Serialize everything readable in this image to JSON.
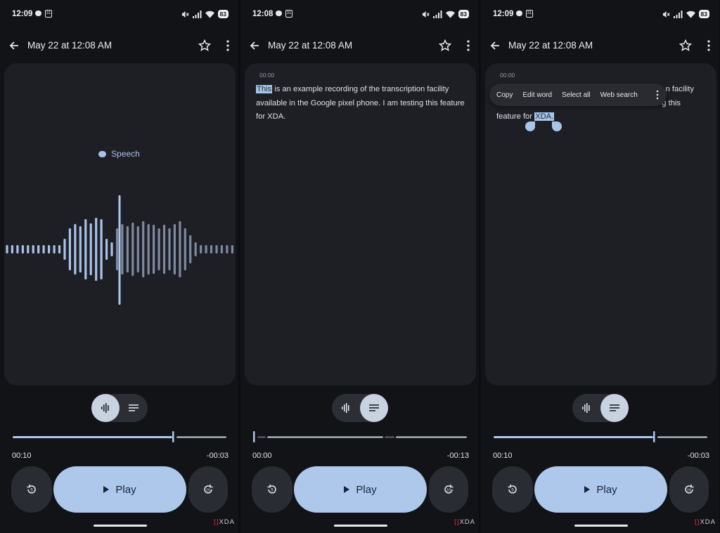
{
  "panels": [
    {
      "status": {
        "time": "12:09",
        "calendar_day": "31",
        "battery": "83"
      },
      "header": {
        "title": "May 22 at 12:08 AM"
      },
      "content": {
        "mode": "waveform",
        "sound_label": "Speech"
      },
      "view_toggle": {
        "active": "audio"
      },
      "player": {
        "elapsed": "00:10",
        "remaining": "-00:03",
        "progress": 0.75,
        "play_label": "Play",
        "rewind_seconds": "5",
        "forward_seconds": "10"
      },
      "watermark": "XDA"
    },
    {
      "status": {
        "time": "12:08",
        "calendar_day": "31",
        "battery": "83"
      },
      "header": {
        "title": "May 22 at 12:08 AM"
      },
      "content": {
        "mode": "transcript",
        "timestamp": "00:00",
        "highlight_word": "This",
        "text_after": " is an example recording of the transcription facility available in the Google pixel phone. I am testing this feature for XDA."
      },
      "view_toggle": {
        "active": "transcript"
      },
      "player": {
        "elapsed": "00:00",
        "remaining": "-00:13",
        "progress": 0.0,
        "play_label": "Play",
        "rewind_seconds": "5",
        "forward_seconds": "10"
      },
      "watermark": "XDA"
    },
    {
      "status": {
        "time": "12:09",
        "calendar_day": "31",
        "battery": "83"
      },
      "header": {
        "title": "May 22 at 12:08 AM"
      },
      "content": {
        "mode": "transcript-selection",
        "timestamp": "00:00",
        "line1_end": "n facility",
        "line2_end": "g this",
        "line3_prefix": "feature for ",
        "selected_word": "XDA."
      },
      "context_menu": {
        "items": [
          "Copy",
          "Edit word",
          "Select all",
          "Web search"
        ]
      },
      "view_toggle": {
        "active": "transcript"
      },
      "player": {
        "elapsed": "00:10",
        "remaining": "-00:03",
        "progress": 0.75,
        "play_label": "Play",
        "rewind_seconds": "5",
        "forward_seconds": "10"
      },
      "watermark": "XDA"
    }
  ],
  "colors": {
    "background": "#121317",
    "card": "#1e1f25",
    "accent": "#aec8ec",
    "waveform": "#a9c3e8",
    "watermark_accent": "#e0304a"
  },
  "icons": {
    "back": "arrow-back-icon",
    "star": "star-outline-icon",
    "more": "more-vert-icon",
    "audio_view": "waveform-icon",
    "transcript_view": "transcript-lines-icon",
    "rewind": "replay-5-icon",
    "forward": "forward-10-icon"
  }
}
